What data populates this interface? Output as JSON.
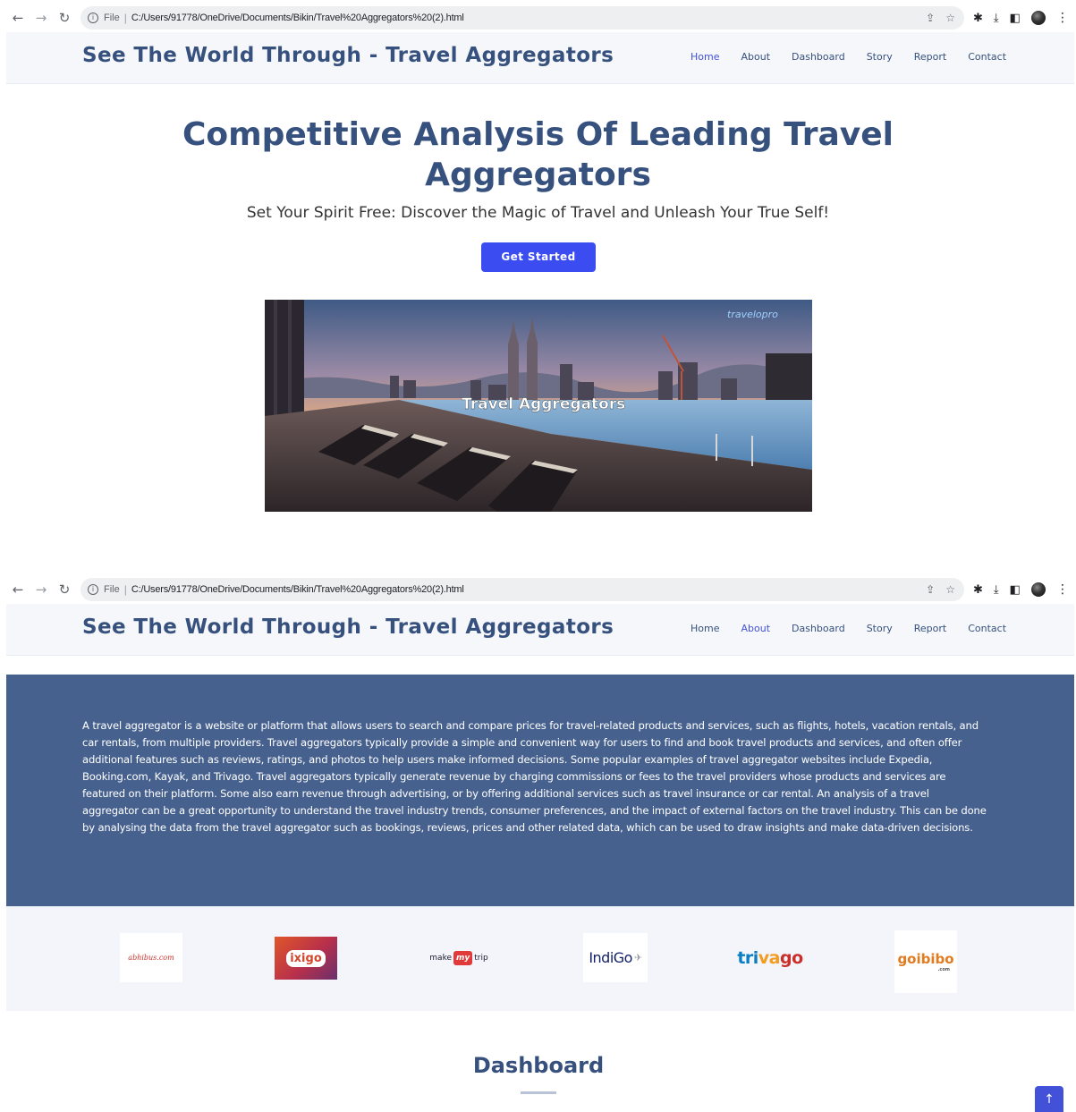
{
  "browser": {
    "scheme_label": "File",
    "url": "C:/Users/91778/OneDrive/Documents/Bikin/Travel%20Aggregators%20(2).html",
    "icons": [
      "back-arrow-icon",
      "forward-arrow-icon",
      "reload-icon",
      "info-icon",
      "share-icon",
      "star-icon",
      "extensions-icon",
      "download-icon",
      "sidebar-icon",
      "profile-avatar",
      "menu-dots-icon"
    ]
  },
  "site": {
    "title": "See The World Through - Travel Aggregators",
    "nav": [
      "Home",
      "About",
      "Dashboard",
      "Story",
      "Report",
      "Contact"
    ]
  },
  "screens": [
    {
      "active_nav": "Home"
    },
    {
      "active_nav": "About"
    }
  ],
  "hero": {
    "title": "Competitive Analysis Of Leading Travel Aggregators",
    "subtitle": "Set Your Spirit Free: Discover the Magic of Travel and Unleash Your True Self!",
    "button": "Get Started",
    "image": {
      "brand": "travelopro",
      "caption": "Travel Aggregators"
    }
  },
  "about": {
    "text": "A travel aggregator is a website or platform that allows users to search and compare prices for travel-related products and services, such as flights, hotels, vacation rentals, and car rentals, from multiple providers. Travel aggregators typically provide a simple and convenient way for users to find and book travel products and services, and often offer additional features such as reviews, ratings, and photos to help users make informed decisions. Some popular examples of travel aggregator websites include Expedia, Booking.com, Kayak, and Trivago. Travel aggregators typically generate revenue by charging commissions or fees to the travel providers whose products and services are featured on their platform. Some also earn revenue through advertising, or by offering additional services such as travel insurance or car rental. An analysis of a travel aggregator can be a great opportunity to understand the travel industry trends, consumer preferences, and the impact of external factors on the travel industry. This can be done by analysing the data from the travel aggregator such as bookings, reviews, prices and other related data, which can be used to draw insights and make data-driven decisions."
  },
  "clients": {
    "abhibus": "abhibus.com",
    "ixigo": "ixigo",
    "makemytrip": {
      "make": "make",
      "my": "my",
      "trip": "trip"
    },
    "indigo": "IndiGo",
    "trivago": {
      "tri": "tri",
      "va": "va",
      "go": "go"
    },
    "goibibo": {
      "name": "goibibo",
      "suffix": ".com"
    }
  },
  "dashboard": {
    "title": "Dashboard"
  },
  "colors": {
    "primary": "#37517e",
    "accent": "#3b4cf0",
    "nav_active": "#4351d8",
    "about_bg": "#47618e"
  }
}
